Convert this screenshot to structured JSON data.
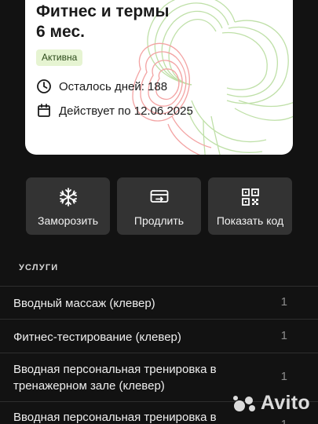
{
  "membership": {
    "title_line1": "Фитнес и термы",
    "title_line2": "6 мес.",
    "status": "Активна",
    "days_left": "Осталось дней: 188",
    "valid_until": "Действует по 12.06.2025",
    "colors": {
      "badge_bg": "#e6f4d2",
      "badge_text": "#2c4a1a",
      "art_green": "#bfe0a8",
      "art_red": "#f3a3a3"
    }
  },
  "actions": [
    {
      "label": "Заморозить",
      "icon": "snowflake-icon"
    },
    {
      "label": "Продлить",
      "icon": "card-renew-icon"
    },
    {
      "label": "Показать код",
      "icon": "qr-code-icon"
    }
  ],
  "services": {
    "title": "УСЛУГИ",
    "items": [
      {
        "name": "Вводный массаж (клевер)",
        "qty": "1"
      },
      {
        "name": "Фитнес-тестирование (клевер)",
        "qty": "1"
      },
      {
        "name": "Вводная персональная тренировка в тренажерном зале (клевер)",
        "qty": "1"
      },
      {
        "name": "Вводная персональная тренировка в",
        "qty": "1"
      }
    ]
  },
  "watermark": {
    "text": "Avito"
  }
}
